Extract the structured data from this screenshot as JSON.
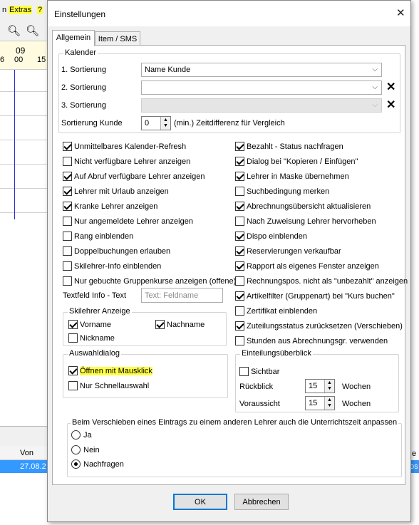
{
  "background": {
    "menu_view": "n",
    "menu_extras": "Extras",
    "menu_help": "?",
    "cal_date": "09",
    "cal_hour_a": "00",
    "cal_hour_b": "15",
    "cal_hour_left": "6",
    "col_von": "Von",
    "row_date": "27.08.2",
    "right_col": "e",
    "right_row": "os"
  },
  "dialog": {
    "title": "Einstellungen",
    "tabs": [
      "Allgemein",
      "Item / SMS"
    ],
    "kalender": {
      "legend": "Kalender",
      "sort1_label": "1. Sortierung",
      "sort1_value": "Name Kunde",
      "sort2_label": "2. Sortierung",
      "sort2_value": "",
      "sort3_label": "3. Sortierung",
      "sort3_value": "",
      "sort_kunde_label": "Sortierung Kunde",
      "sort_kunde_value": "0",
      "sort_kunde_suffix": "(min.) Zeitdifferenz für Vergleich"
    },
    "left_checks": [
      {
        "label": "Unmittelbares Kalender-Refresh",
        "checked": true
      },
      {
        "label": "Nicht verfügbare Lehrer anzeigen",
        "checked": false
      },
      {
        "label": "Auf Abruf verfügbare Lehrer anzeigen",
        "checked": true
      },
      {
        "label": "Lehrer mit Urlaub anzeigen",
        "checked": true
      },
      {
        "label": "Kranke Lehrer anzeigen",
        "checked": true
      },
      {
        "label": "Nur angemeldete Lehrer anzeigen",
        "checked": false
      },
      {
        "label": "Rang einblenden",
        "checked": false
      },
      {
        "label": "Doppelbuchungen erlauben",
        "checked": false
      },
      {
        "label": "Skilehrer-Info einblenden",
        "checked": false
      },
      {
        "label": "Nur gebuchte Gruppenkurse anzeigen (offene)",
        "checked": false
      }
    ],
    "right_checks": [
      {
        "label": "Bezahlt - Status nachfragen",
        "checked": true
      },
      {
        "label": "Dialog bei \"Kopieren / Einfügen\"",
        "checked": true
      },
      {
        "label": "Lehrer in Maske übernehmen",
        "checked": true
      },
      {
        "label": "Suchbedingung merken",
        "checked": false
      },
      {
        "label": "Abrechnungsübersicht aktualisieren",
        "checked": true
      },
      {
        "label": "Nach Zuweisung Lehrer hervorheben",
        "checked": false
      },
      {
        "label": "Dispo einblenden",
        "checked": true
      },
      {
        "label": "Reservierungen verkaufbar",
        "checked": true
      },
      {
        "label": "Rapport als eigenes Fenster anzeigen",
        "checked": true
      },
      {
        "label": "Rechnungspos. nicht als \"unbezahlt\" anzeigen",
        "checked": false
      },
      {
        "label": "Artikelfilter (Gruppenart) bei \"Kurs buchen\"",
        "checked": true
      },
      {
        "label": "Zertifikat einblenden",
        "checked": false
      },
      {
        "label": "Zuteilungsstatus zurücksetzen (Verschieben)",
        "checked": true
      },
      {
        "label": "Stunden aus Abrechnungsgr. verwenden",
        "checked": false
      }
    ],
    "textfeld_label": "Textfeld Info - Text",
    "textfeld_placeholder": "Text: Feldname",
    "skilehrer": {
      "legend": "Skilehrer Anzeige",
      "vorname": "Vorname",
      "vorname_checked": true,
      "nachname": "Nachname",
      "nachname_checked": true,
      "nickname": "Nickname",
      "nickname_checked": false
    },
    "auswahl": {
      "legend": "Auswahldialog",
      "mausklick": "Öffnen mit Mausklick",
      "mausklick_checked": true,
      "schnell": "Nur Schnellauswahl",
      "schnell_checked": false
    },
    "einteilung": {
      "legend": "Einteilungsüberblick",
      "sichtbar": "Sichtbar",
      "sichtbar_checked": false,
      "rueckblick_label": "Rückblick",
      "rueckblick_value": "15",
      "rueckblick_unit": "Wochen",
      "voraussicht_label": "Voraussicht",
      "voraussicht_value": "15",
      "voraussicht_unit": "Wochen"
    },
    "verschieben": {
      "legend": "Beim Verschieben eines Eintrags zu einem anderen Lehrer auch die Unterrichtszeit anpassen",
      "options": [
        "Ja",
        "Nein",
        "Nachfragen"
      ],
      "selected": "Nachfragen"
    },
    "ok_label": "OK",
    "cancel_label": "Abbrechen",
    "colors": {
      "highlight": "#ffff44",
      "selection": "#3399ff",
      "default_button_border": "#0078d7"
    }
  }
}
